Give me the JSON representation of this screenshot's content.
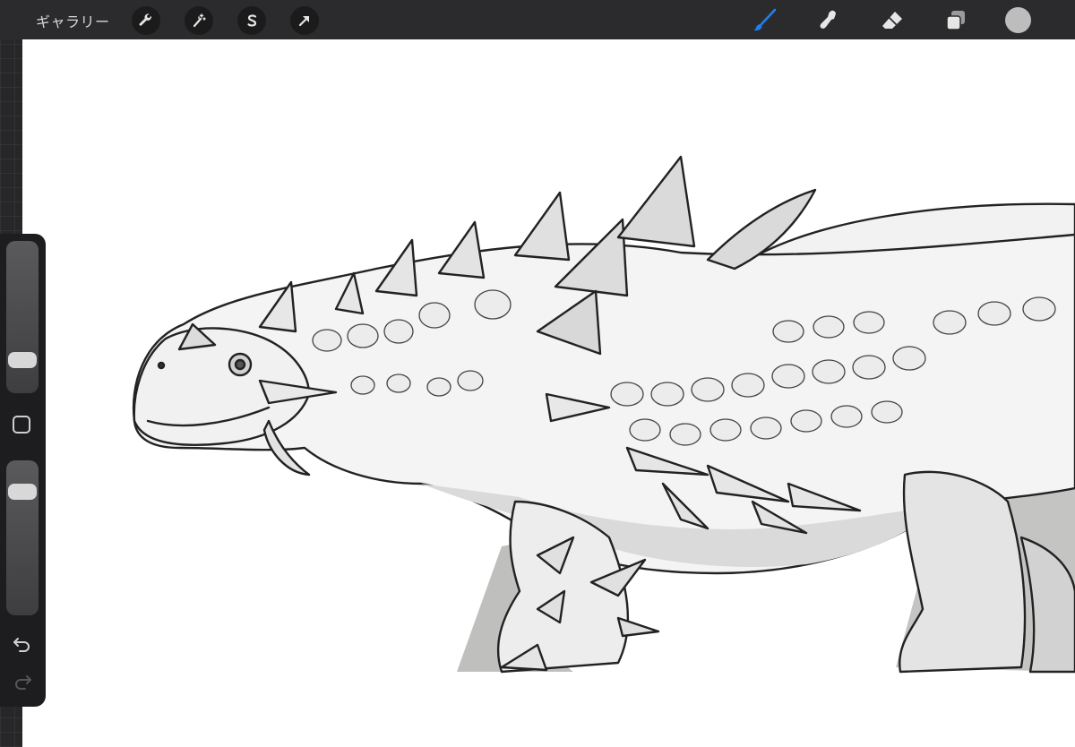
{
  "topbar": {
    "gallery_label": "ギャラリー",
    "tools_left": [
      "wrench-icon",
      "magic-wand-icon",
      "selection-s-icon",
      "transform-arrow-icon"
    ],
    "tools_right": [
      "brush-icon",
      "smudge-icon",
      "eraser-icon",
      "layers-icon"
    ],
    "active_tool": "brush-icon",
    "active_color": "#1e7ff0",
    "current_color": "#bdbdbd"
  },
  "sidebar": {
    "brush_size_level": 0.17,
    "opacity_level": 0.85,
    "icons": [
      "modify-square-icon",
      "undo-icon",
      "redo-icon"
    ]
  },
  "canvas": {
    "subject": "ankylosaur-sketch"
  }
}
